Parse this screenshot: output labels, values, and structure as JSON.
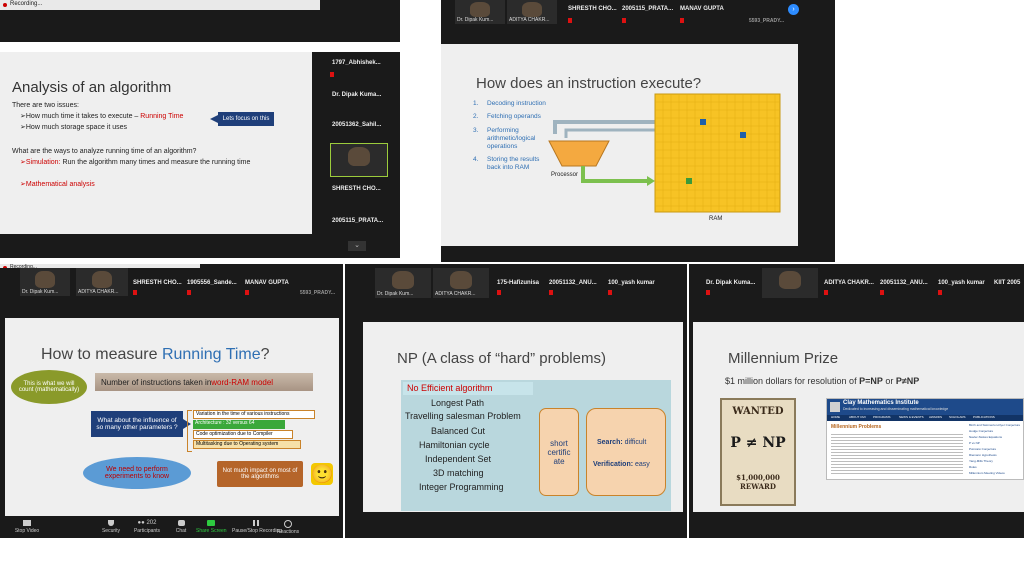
{
  "p1": {
    "window_title": "Recording...",
    "participants": [
      "1797_Abhishek...",
      "Dr. Dipak Kuma...",
      "20051362_Sahil...",
      "SHRESTH CHO...",
      "2005115_PRATA..."
    ],
    "slide": {
      "title": "Analysis of an algorithm",
      "intro": "There are two issues:",
      "b1_pre": "➢How much time it takes to execute – ",
      "b1_red": "Running Time",
      "b2": "➢How much storage space it uses",
      "callout": "Lets focus on this",
      "q": "What are the ways to analyze running time of an algorithm?",
      "sim_red": "➢Simulation:",
      "sim_rest": " Run the algorithm many times and measure the running time",
      "math": "➢Mathematical analysis"
    }
  },
  "p2": {
    "participants": [
      "SHRESTH CHO...",
      "2005115_PRATA...",
      "MANAV GUPTA"
    ],
    "tile_labels": [
      "Dr. Dipak Kum...",
      "ADITYA CHAKR...",
      "5593_PRADY..."
    ],
    "slide": {
      "title": "How does an instruction execute?",
      "steps": [
        {
          "n": "1.",
          "t": "Decoding instruction"
        },
        {
          "n": "2.",
          "t": "Fetching operands"
        },
        {
          "n": "3.",
          "t": "Performing arithmetic/logical operations"
        },
        {
          "n": "4.",
          "t": "Storing the results back into RAM"
        }
      ],
      "processor": "Processor",
      "ram": "RAM"
    }
  },
  "p3": {
    "window_title": "Recording...",
    "participants": [
      "SHRESTH CHO...",
      "1905556_Sande...",
      "MANAV GUPTA"
    ],
    "tile_labels": [
      "Dr. Dipak Kum...",
      "ADITYA CHAKR...",
      "5593_PRADY..."
    ],
    "slide": {
      "title_pre": "How to measure ",
      "title_blue": "Running Time",
      "title_post": "?",
      "oval": "This is what we will count (mathematically)",
      "banner_pre": "Number of instructions taken in ",
      "banner_red": "word-RAM model",
      "influence": "What about the influence of so many other parameters ?",
      "list": [
        "Variation in the time of various instructions",
        "Architecture : 32 versus 64",
        "Code optimization due to Compiler",
        "Multitasking  due to Operating system"
      ],
      "experiments": "We need to perform experiments to know",
      "impact": "Not much impact on most of the algorithms",
      "smiley": "🙂"
    },
    "toolbar": [
      "Stop Video",
      "Security",
      "Participants",
      "Chat",
      "Share Screen",
      "Pause/Stop Recording",
      "Reactions"
    ],
    "participant_count": "202"
  },
  "p4": {
    "participants": [
      "175-Hafizunisa",
      "20051132_ANU...",
      "100_yash kumar"
    ],
    "tile_labels": [
      "Dr. Dipak Kum...",
      "ADITYA CHAKR..."
    ],
    "slide": {
      "title": "NP (A class of “hard” problems)",
      "header": "No Efficient algorithm",
      "rows": [
        "Longest Path",
        "Travelling salesman Problem",
        "Balanced Cut",
        "Hamiltonian cycle",
        "Independent Set",
        "3D matching",
        "Integer Programming"
      ],
      "short": "short certific ate",
      "search_b": "Search:",
      "search_r": " difficult",
      "verif_b": "Verification:",
      "verif_r": " easy"
    }
  },
  "p5": {
    "participants": [
      "Dr. Dipak Kuma...",
      "ADITYA CHAKR...",
      "20051132_ANU...",
      "100_yash kumar",
      "KIIT 2005"
    ],
    "slide": {
      "title": "Millennium Prize",
      "subtitle_pre": "$1 million dollars for resolution of ",
      "subtitle_b": "P=NP",
      "subtitle_mid": " or ",
      "subtitle_b2": "P≠NP",
      "poster_top": "WANTED",
      "poster_mid": "P ≠ NP",
      "poster_amt": "$1,000,000",
      "poster_reward": "REWARD",
      "clay_title": "Clay Mathematics Institute",
      "clay_sub": "Dedicated to increasing and disseminating mathematical knowledge",
      "clay_nav": [
        "HOME",
        "ABOUT CMI",
        "PROGRAMS",
        "NEWS & EVENTS",
        "AWARDS",
        "SCHOLARS",
        "PUBLICATIONS"
      ],
      "clay_heading": "Millennium Problems",
      "clay_side": [
        "Birch and Swinnerton-Dyer Conjecture",
        "Hodge Conjecture",
        "Navier-Stokes Equations",
        "P vs NP",
        "Poincaré Conjecture",
        "Riemann Hypothesis",
        "Yang-Mills Theory",
        "Rules",
        "Millennium Meeting Videos"
      ]
    }
  }
}
